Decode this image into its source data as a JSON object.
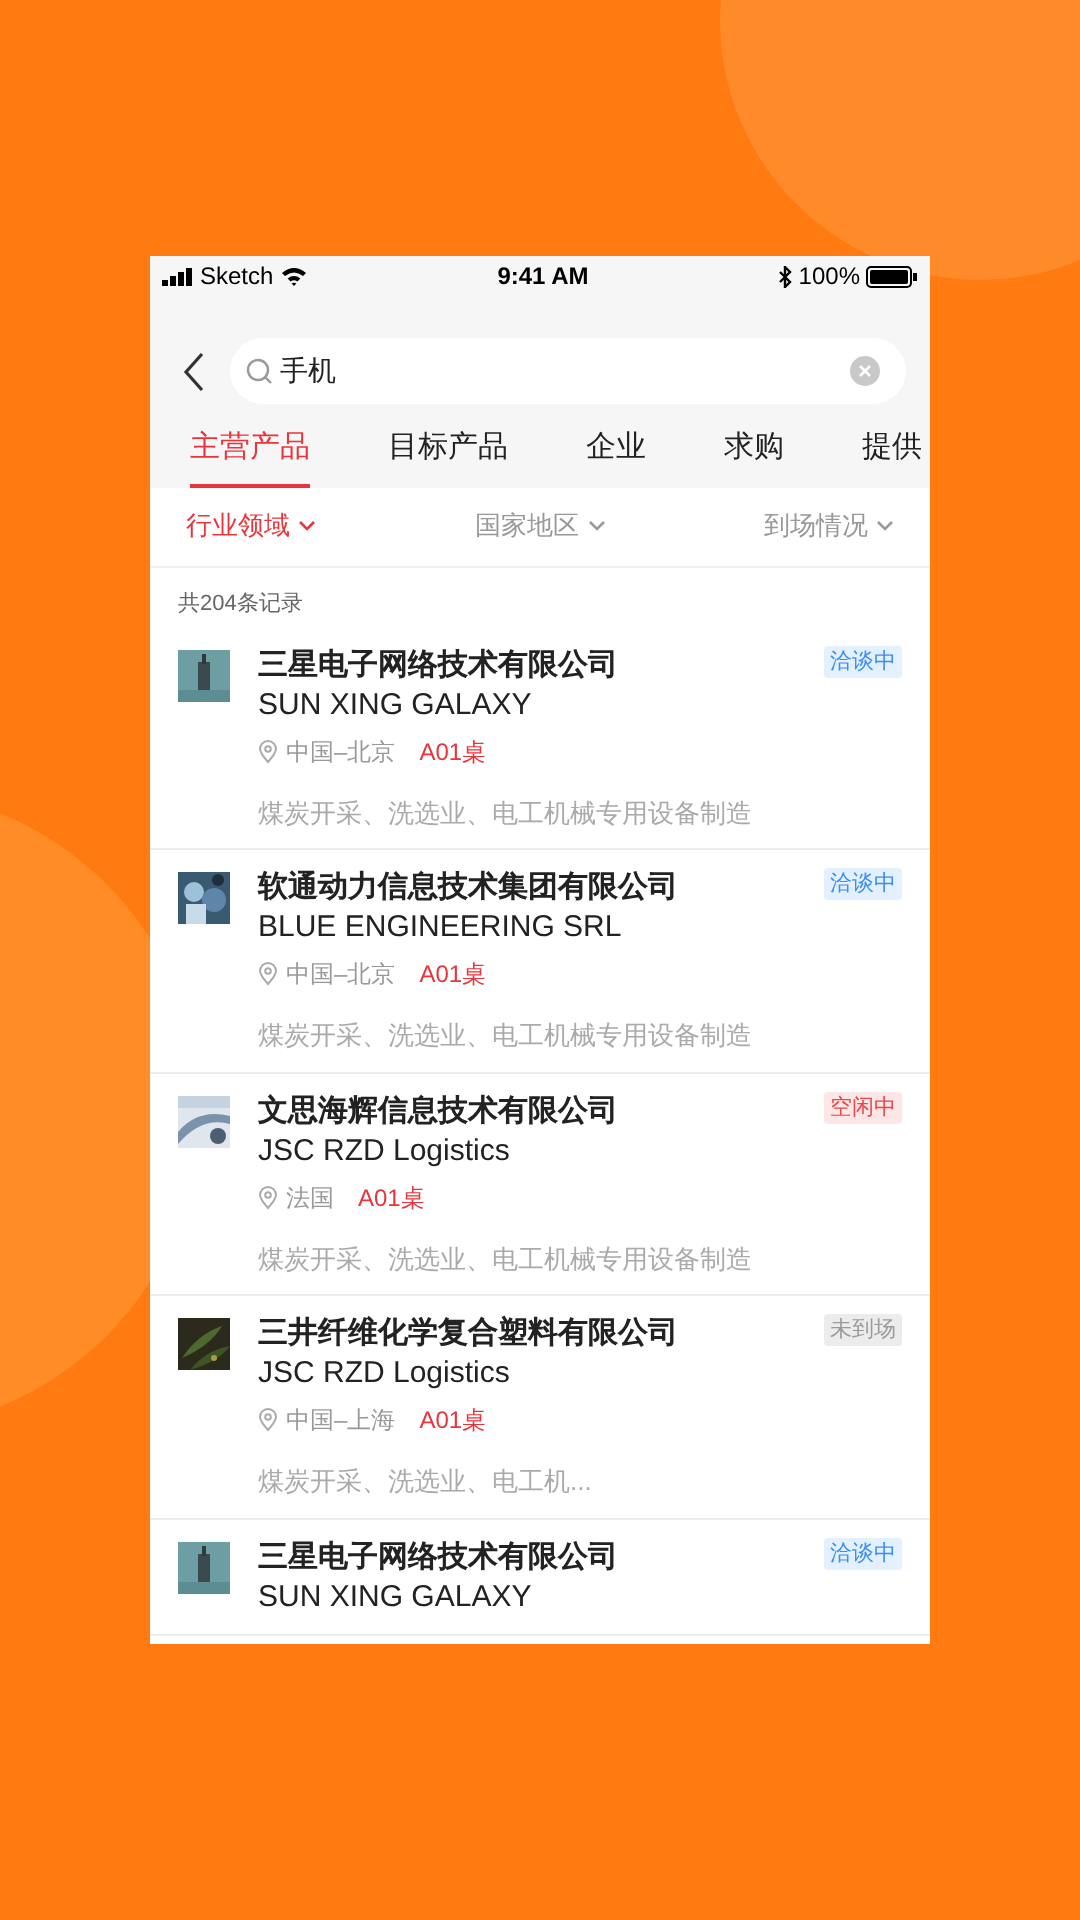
{
  "status_bar": {
    "carrier": "Sketch",
    "time": "9:41 AM",
    "battery": "100%"
  },
  "search": {
    "value": "手机"
  },
  "tabs": [
    {
      "label": "主营产品",
      "selected": true
    },
    {
      "label": "目标产品",
      "selected": false
    },
    {
      "label": "企业",
      "selected": false
    },
    {
      "label": "求购",
      "selected": false
    },
    {
      "label": "提供",
      "selected": false
    }
  ],
  "filters": [
    {
      "label": "行业领域",
      "selected": true
    },
    {
      "label": "国家地区",
      "selected": false
    },
    {
      "label": "到场情况",
      "selected": false
    }
  ],
  "record_count": "共204条记录",
  "companies": [
    {
      "name": "三星电子网络技术有限公司",
      "name_en": "SUN XING GALAXY",
      "location": "中国–北京",
      "desk": "A01桌",
      "industry": "煤炭开采、洗选业、电工机械专用设备制造",
      "status": {
        "label": "洽谈中",
        "kind": "negotiating"
      }
    },
    {
      "name": "软通动力信息技术集团有限公司",
      "name_en": "BLUE ENGINEERING SRL",
      "location": "中国–北京",
      "desk": "A01桌",
      "industry": "煤炭开采、洗选业、电工机械专用设备制造",
      "status": {
        "label": "洽谈中",
        "kind": "negotiating"
      }
    },
    {
      "name": "文思海辉信息技术有限公司",
      "name_en": "JSC RZD Logistics",
      "location": "法国",
      "desk": "A01桌",
      "industry": "煤炭开采、洗选业、电工机械专用设备制造",
      "status": {
        "label": "空闲中",
        "kind": "idle"
      }
    },
    {
      "name": "三井纤维化学复合塑料有限公司",
      "name_en": "JSC RZD Logistics",
      "location": "中国–上海",
      "desk": "A01桌",
      "industry": "煤炭开采、洗选业、电工机...",
      "status": {
        "label": "未到场",
        "kind": "absent"
      }
    },
    {
      "name": "三星电子网络技术有限公司",
      "name_en": "SUN XING GALAXY",
      "status": {
        "label": "洽谈中",
        "kind": "negotiating"
      }
    }
  ]
}
